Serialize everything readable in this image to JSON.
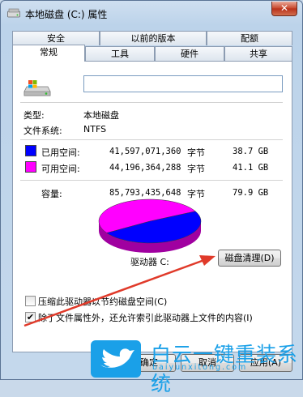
{
  "window": {
    "title": "本地磁盘 (C:) 属性",
    "close_label": "✕"
  },
  "tabs_row1": [
    "安全",
    "以前的版本",
    "配额"
  ],
  "tabs_row2": [
    "常规",
    "工具",
    "硬件",
    "共享"
  ],
  "active_tab": "常规",
  "general": {
    "volume_label_value": "",
    "type_label": "类型:",
    "type_value": "本地磁盘",
    "fs_label": "文件系统:",
    "fs_value": "NTFS",
    "used_label": "已用空间:",
    "used_bytes": "41,597,071,360",
    "used_unit": "字节",
    "used_gb": "38.7 GB",
    "free_label": "可用空间:",
    "free_bytes": "44,196,364,288",
    "free_unit": "字节",
    "free_gb": "41.1 GB",
    "capacity_label": "容量:",
    "capacity_bytes": "85,793,435,648",
    "capacity_unit": "字节",
    "capacity_gb": "79.9 GB",
    "drive_label": "驱动器 C:",
    "cleanup_button": "磁盘清理(D)",
    "compress_label": "压缩此驱动器以节约磁盘空间(C)",
    "compress_checked": false,
    "index_label": "除了文件属性外，还允许索引此驱动器上文件的内容(I)",
    "index_checked": true
  },
  "colors": {
    "used": "#0000ff",
    "free": "#ff00ff",
    "accent_arrow": "#e03a2a",
    "watermark": "#1aa0e8"
  },
  "usage": {
    "used_fraction": 0.485,
    "free_fraction": 0.515
  },
  "buttons": {
    "ok": "确定",
    "cancel": "取消",
    "apply": "应用(A)"
  },
  "watermark": {
    "text": "白云一键重装系统",
    "url": "baiyunxitong.com"
  }
}
